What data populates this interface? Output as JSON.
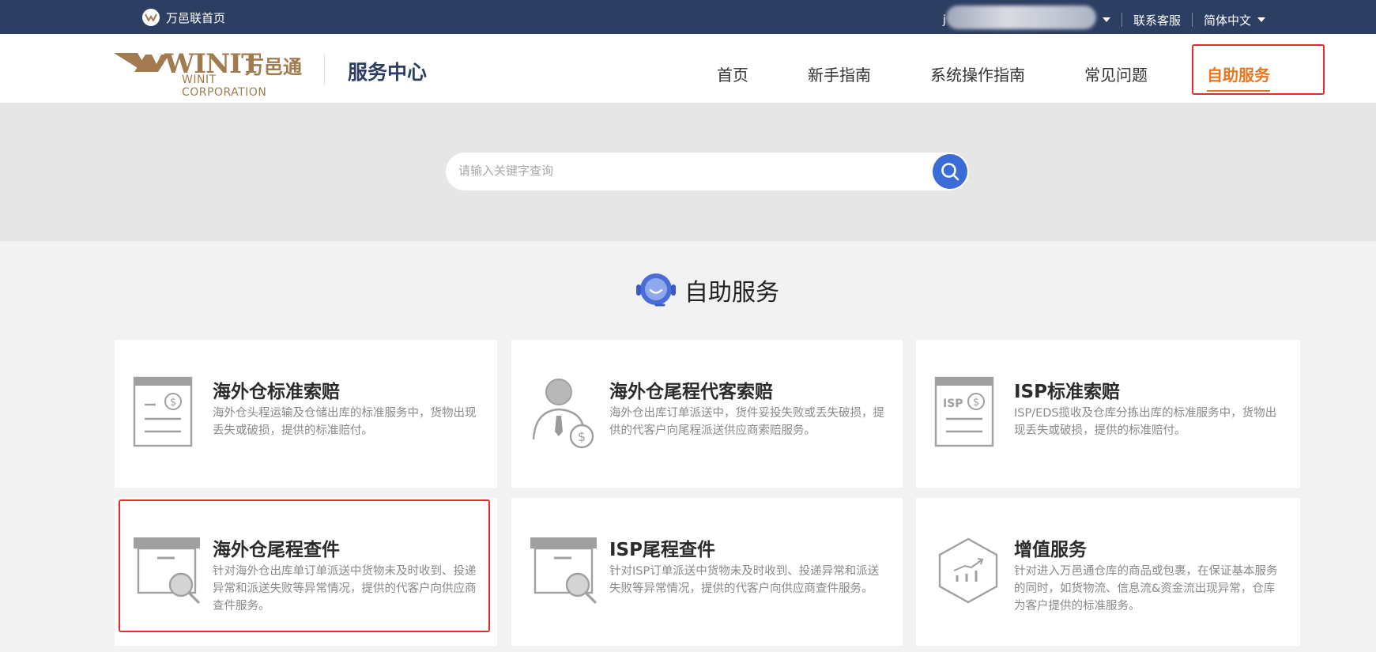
{
  "topbar": {
    "home_link": "万邑联首页",
    "user_name_prefix": "j",
    "contact": "联系客服",
    "language": "简体中文"
  },
  "header": {
    "brand_logo_text": "WINIT",
    "brand_cn": "万邑通",
    "brand_en": "WINIT CORPORATION",
    "service_center": "服务中心",
    "nav": [
      {
        "label": "首页"
      },
      {
        "label": "新手指南"
      },
      {
        "label": "系统操作指南"
      },
      {
        "label": "常见问题"
      },
      {
        "label": "自助服务",
        "active": true
      }
    ]
  },
  "search": {
    "placeholder": "请输入关键字查询"
  },
  "section": {
    "title": "自助服务"
  },
  "cards": [
    {
      "icon": "document-dollar-icon",
      "title": "海外仓标准索赔",
      "desc": "海外仓头程运输及仓储出库的标准服务中，货物出现丢失或破损，提供的标准赔付。"
    },
    {
      "icon": "person-dollar-icon",
      "title": "海外仓尾程代客索赔",
      "desc": "海外仓出库订单派送中，货件妥投失败或丢失破损，提供的代客户向尾程派送供应商索赔服务。"
    },
    {
      "icon": "isp-document-icon",
      "title": "ISP标准索赔",
      "desc": "ISP/EDS揽收及仓库分拣出库的标准服务中，货物出现丢失或破损，提供的标准赔付。"
    },
    {
      "icon": "box-search-icon",
      "title": "海外仓尾程查件",
      "desc": "针对海外仓出库单订单派送中货物未及时收到、投递异常和派送失败等异常情况，提供的代客户向供应商查件服务。"
    },
    {
      "icon": "box-search-icon",
      "title": "ISP尾程查件",
      "desc": "针对ISP订单派送中货物未及时收到、投递异常和派送失败等异常情况，提供的代客户向供应商查件服务。"
    },
    {
      "icon": "hexagon-chart-icon",
      "title": "增值服务",
      "desc": "针对进入万邑通仓库的商品或包裹，在保证基本服务的同时，如货物流、信息流&资金流出现异常，仓库为客户提供的标准服务。"
    }
  ],
  "colors": {
    "topbar_bg": "#2d3e63",
    "accent_orange": "#e87722",
    "search_btn": "#3b6bd6",
    "brand_gold": "#a17b4f",
    "highlight_red": "#e62b2b"
  }
}
